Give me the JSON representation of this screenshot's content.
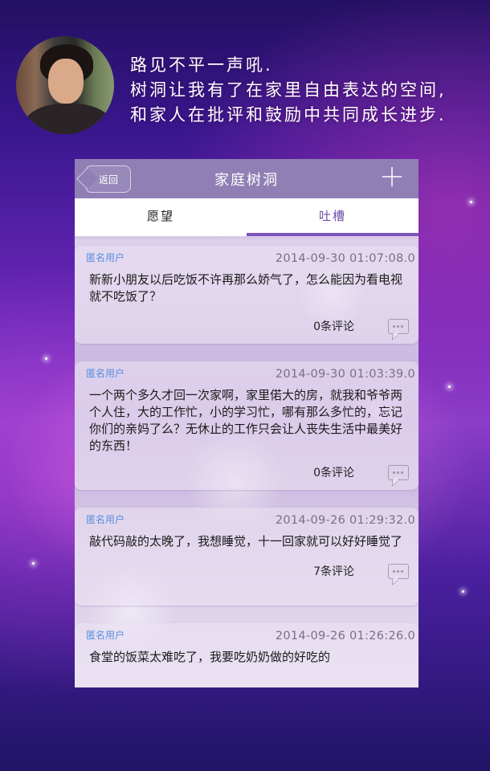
{
  "header": {
    "lines": [
      "路见不平一声吼.",
      "树洞让我有了在家里自由表达的空间,",
      "和家人在批评和鼓励中共同成长进步."
    ]
  },
  "app": {
    "title": "家庭树洞",
    "back_label": "返回",
    "add_icon": "plus-icon",
    "tabs": [
      {
        "label": "愿望",
        "active": false
      },
      {
        "label": "吐槽",
        "active": true
      }
    ],
    "accent_color": "#7b55b9",
    "posts": [
      {
        "user": "匿名用户",
        "time": "2014-09-30 01:07:08.0",
        "content": "新新小朋友以后吃饭不许再那么娇气了，怎么能因为看电视就不吃饭了？",
        "comments": "0条评论"
      },
      {
        "user": "匿名用户",
        "time": "2014-09-30 01:03:39.0",
        "content": "一个两个多久才回一次家啊，家里偌大的房，就我和爷爷两个人住，大的工作忙，小的学习忙，哪有那么多忙的，忘记你们的亲妈了么？无休止的工作只会让人丧失生活中最美好的东西！",
        "comments": "0条评论"
      },
      {
        "user": "匿名用户",
        "time": "2014-09-26 01:29:32.0",
        "content": "敲代码敲的太晚了，我想睡觉，十一回家就可以好好睡觉了",
        "comments": "7条评论"
      },
      {
        "user": "匿名用户",
        "time": "2014-09-26 01:26:26.0",
        "content": "食堂的饭菜太难吃了，我要吃奶奶做的好吃的",
        "comments": ""
      }
    ]
  }
}
